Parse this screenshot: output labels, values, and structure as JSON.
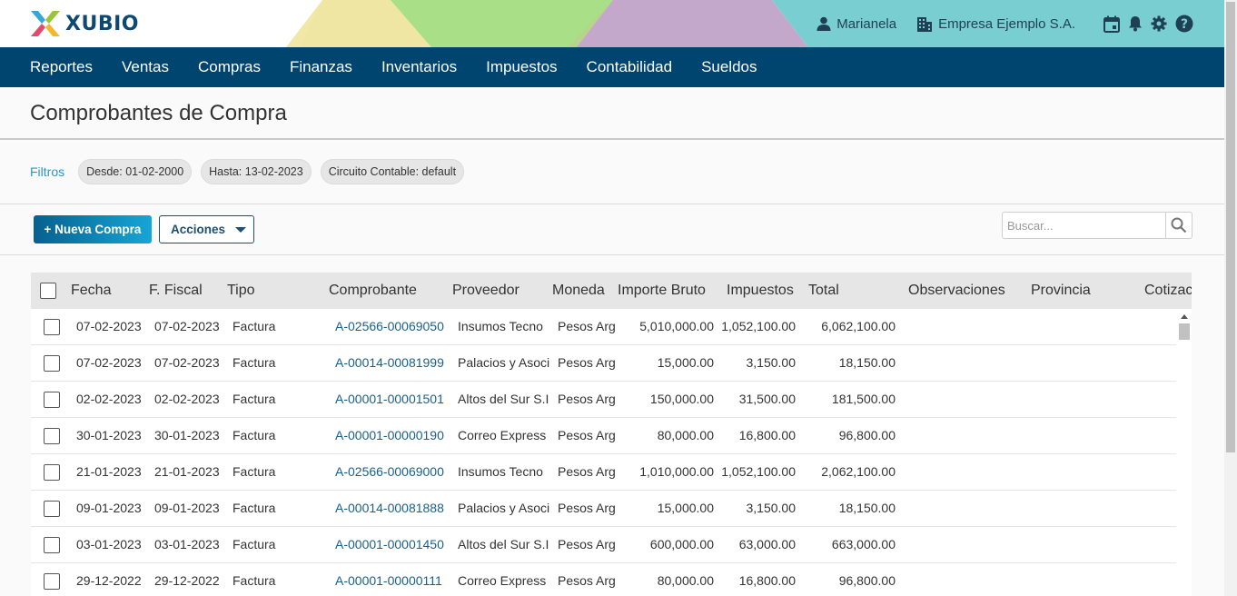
{
  "brand": {
    "name": "XUBIO"
  },
  "header": {
    "user_name": "Marianela",
    "company_name": "Empresa Ejemplo S.A."
  },
  "nav": {
    "items": [
      "Reportes",
      "Ventas",
      "Compras",
      "Finanzas",
      "Inventarios",
      "Impuestos",
      "Contabilidad",
      "Sueldos"
    ]
  },
  "page": {
    "title": "Comprobantes de Compra"
  },
  "filters": {
    "label": "Filtros",
    "chips": [
      "Desde: 01-02-2000",
      "Hasta: 13-02-2023",
      "Circuito Contable: default"
    ]
  },
  "toolbar": {
    "new_label": "+ Nueva Compra",
    "actions_label": "Acciones",
    "search_placeholder": "Buscar..."
  },
  "table": {
    "columns": [
      "Fecha",
      "F. Fiscal",
      "Tipo",
      "Comprobante",
      "Proveedor",
      "Moneda",
      "Importe Bruto",
      "Impuestos",
      "Total",
      "Observaciones",
      "Provincia",
      "Cotizac"
    ],
    "rows": [
      {
        "fecha": "07-02-2023",
        "ffiscal": "07-02-2023",
        "tipo": "Factura",
        "comprobante": "A-02566-00069050",
        "proveedor": "Insumos Tecno",
        "moneda": "Pesos Arg",
        "bruto": "5,010,000.00",
        "impuestos": "1,052,100.00",
        "total": "6,062,100.00"
      },
      {
        "fecha": "07-02-2023",
        "ffiscal": "07-02-2023",
        "tipo": "Factura",
        "comprobante": "A-00014-00081999",
        "proveedor": "Palacios y Asoci",
        "moneda": "Pesos Arg",
        "bruto": "15,000.00",
        "impuestos": "3,150.00",
        "total": "18,150.00"
      },
      {
        "fecha": "02-02-2023",
        "ffiscal": "02-02-2023",
        "tipo": "Factura",
        "comprobante": "A-00001-00001501",
        "proveedor": "Altos del Sur S.I",
        "moneda": "Pesos Arg",
        "bruto": "150,000.00",
        "impuestos": "31,500.00",
        "total": "181,500.00"
      },
      {
        "fecha": "30-01-2023",
        "ffiscal": "30-01-2023",
        "tipo": "Factura",
        "comprobante": "A-00001-00000190",
        "proveedor": "Correo Express",
        "moneda": "Pesos Arg",
        "bruto": "80,000.00",
        "impuestos": "16,800.00",
        "total": "96,800.00"
      },
      {
        "fecha": "21-01-2023",
        "ffiscal": "21-01-2023",
        "tipo": "Factura",
        "comprobante": "A-02566-00069000",
        "proveedor": "Insumos Tecno",
        "moneda": "Pesos Arg",
        "bruto": "1,010,000.00",
        "impuestos": "1,052,100.00",
        "total": "2,062,100.00"
      },
      {
        "fecha": "09-01-2023",
        "ffiscal": "09-01-2023",
        "tipo": "Factura",
        "comprobante": "A-00014-00081888",
        "proveedor": "Palacios y Asoci",
        "moneda": "Pesos Arg",
        "bruto": "15,000.00",
        "impuestos": "3,150.00",
        "total": "18,150.00"
      },
      {
        "fecha": "03-01-2023",
        "ffiscal": "03-01-2023",
        "tipo": "Factura",
        "comprobante": "A-00001-00001450",
        "proveedor": "Altos del Sur S.I",
        "moneda": "Pesos Arg",
        "bruto": "600,000.00",
        "impuestos": "63,000.00",
        "total": "663,000.00"
      },
      {
        "fecha": "29-12-2022",
        "ffiscal": "29-12-2022",
        "tipo": "Factura",
        "comprobante": "A-00001-00000111",
        "proveedor": "Correo Express",
        "moneda": "Pesos Arg",
        "bruto": "80,000.00",
        "impuestos": "16,800.00",
        "total": "96,800.00"
      }
    ]
  },
  "colors": {
    "nav_bg": "#004470",
    "brand_blue": "#0d4a73",
    "filter_label": "#2c95cf",
    "link": "#1a5f8d"
  },
  "icons": [
    "user-icon",
    "building-icon",
    "calendar-icon",
    "bell-icon",
    "gear-icon",
    "help-icon",
    "search-icon"
  ]
}
